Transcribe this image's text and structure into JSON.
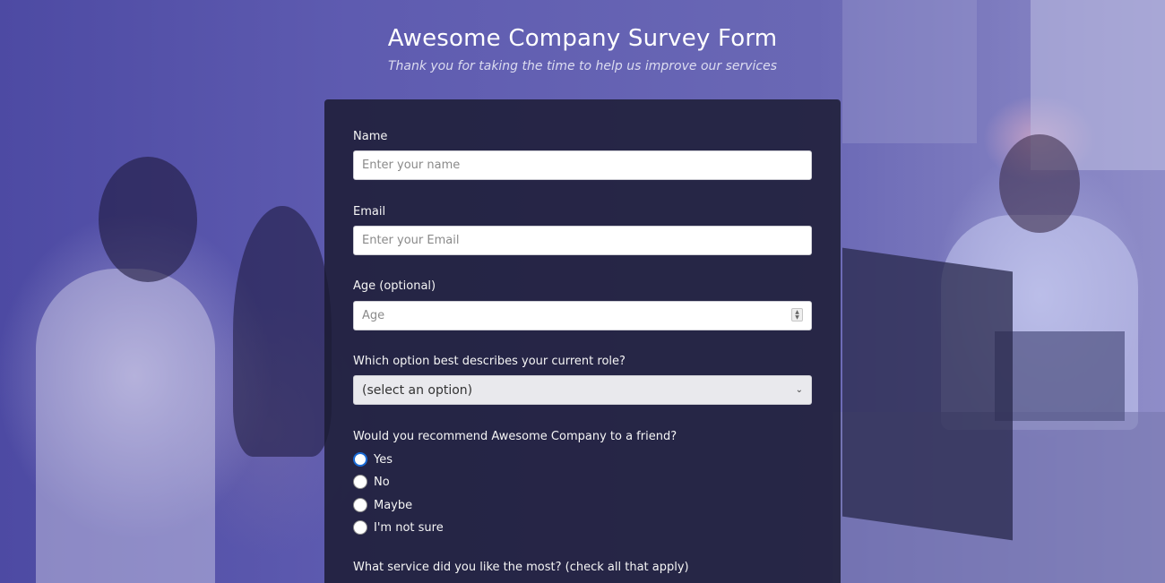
{
  "header": {
    "title": "Awesome Company Survey Form",
    "subtitle": "Thank you for taking the time to help us improve our services"
  },
  "form": {
    "name": {
      "label": "Name",
      "placeholder": "Enter your name",
      "value": ""
    },
    "email": {
      "label": "Email",
      "placeholder": "Enter your Email",
      "value": ""
    },
    "age": {
      "label": "Age (optional)",
      "placeholder": "Age",
      "value": ""
    },
    "role": {
      "label": "Which option best describes your current role?",
      "selected": "(select an option)"
    },
    "recommend": {
      "label": "Would you recommend Awesome Company to a friend?",
      "options": [
        {
          "label": "Yes",
          "checked": true
        },
        {
          "label": "No",
          "checked": false
        },
        {
          "label": "Maybe",
          "checked": false
        },
        {
          "label": "I'm not sure",
          "checked": false
        }
      ]
    },
    "services": {
      "label": "What service did you like the most? (check all that apply)"
    }
  },
  "colors": {
    "background_tint": "#5a57a8",
    "form_panel": "#1b1b32",
    "radio_selected": "#1a6bd6"
  }
}
